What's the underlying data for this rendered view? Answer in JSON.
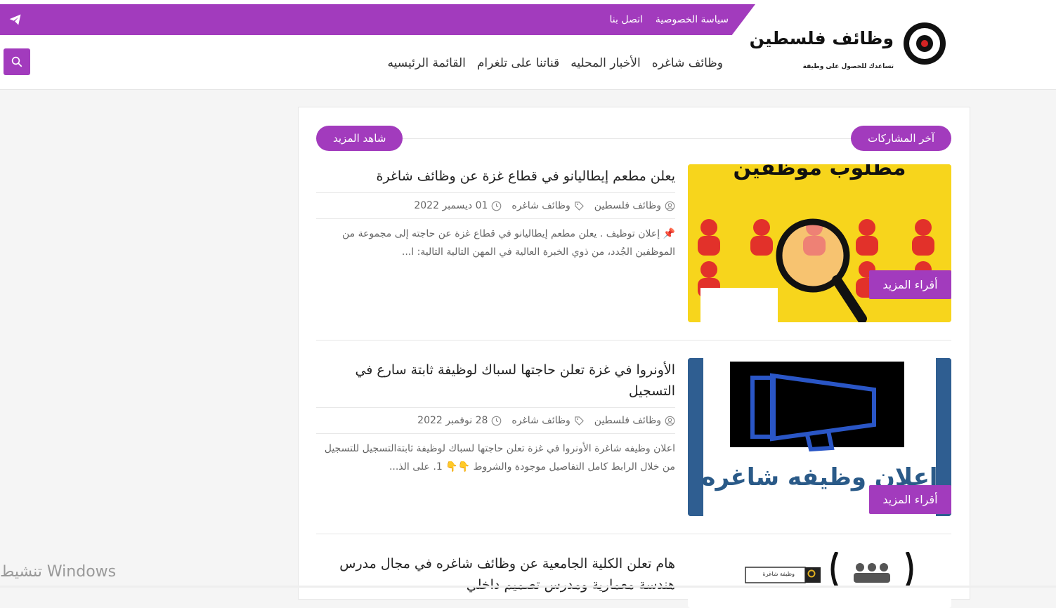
{
  "colors": {
    "accent": "#a23bbd",
    "text": "#222222",
    "muted": "#666666"
  },
  "topbar": {
    "links": [
      "سياسة الخصوصية",
      "اتصل بنا"
    ],
    "icon": "telegram-icon"
  },
  "logo": {
    "title": "وظائف فلسطين",
    "subtitle": "تساعدك للحصول على وظيفة"
  },
  "nav": {
    "items": [
      "القائمة الرئيسيه",
      "قناتنا على تلغرام",
      "الأخبار المحليه",
      "وظائف شاغره"
    ]
  },
  "search": {
    "icon": "search-icon"
  },
  "section": {
    "title": "آخر المشاركات",
    "more_label": "شاهد المزيد"
  },
  "posts": [
    {
      "title": "يعلن مطعم إيطاليانو في قطاع غزة عن وظائف شاغرة",
      "author": "وظائف فلسطين",
      "category": "وظائف شاغره",
      "date": "01 ديسمبر 2022",
      "excerpt": "📌 إعلان توظيف . يعلن مطعم إيطاليانو في قطاع غزة عن حاجته إلى مجموعة من الموظفين الجُدد، من ذوي الخبرة العالية في المهن التالية التالية:  ا...",
      "read_more": "أقراء المزيد",
      "image_text": "مطلوب موظفين"
    },
    {
      "title": "الأونروا في غزة تعلن حاجتها لسباك لوظيفة ثابتة سارع في التسجيل",
      "author": "وظائف فلسطين",
      "category": "وظائف شاغره",
      "date": "28 نوفمبر 2022",
      "excerpt": "اعلان وظيفه شاغرة الأونروا في غزة تعلن حاجتها لسباك لوظيفة ثابتةالتسجيل للتسجيل من خلال الرابط كامل التفاصيل موجودة والشروط 👇👇 1. على الذ...",
      "read_more": "أقراء المزيد",
      "image_text": "اعلان وظيفه شاغره"
    },
    {
      "title": "هام تعلن الكلية الجامعية عن وظائف شاغره في مجال مدرس هندسة معمارية ومدرس تصميم داخلي",
      "image_text": "وظيفة شاغرة"
    }
  ],
  "watermark": "تنشيط Windows"
}
